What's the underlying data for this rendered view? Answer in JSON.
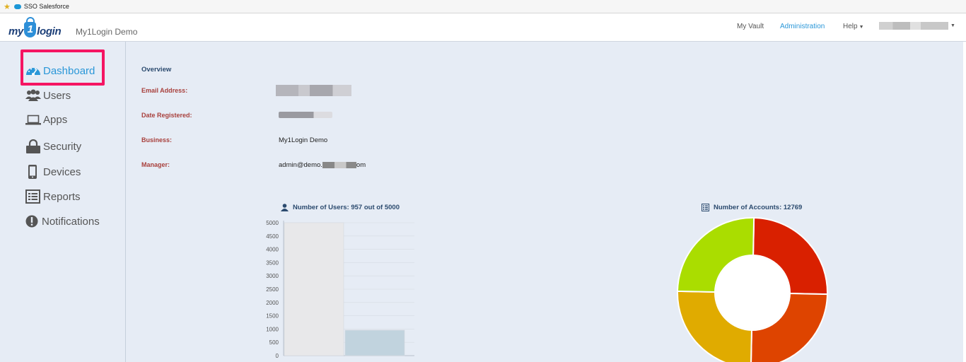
{
  "browser": {
    "bookmark_label": "SSO  Salesforce"
  },
  "header": {
    "logo_left": "my",
    "logo_one": "1",
    "logo_right": "login",
    "app_title": "My1Login Demo",
    "nav": {
      "vault": "My Vault",
      "admin": "Administration",
      "help": "Help"
    }
  },
  "sidebar": {
    "items": [
      {
        "label": "Dashboard",
        "icon": "dashboard-icon",
        "active": true
      },
      {
        "label": "Users",
        "icon": "users-icon"
      },
      {
        "label": "Apps",
        "icon": "laptop-icon"
      },
      {
        "label": "Security",
        "icon": "lock-icon"
      },
      {
        "label": "Devices",
        "icon": "mobile-icon"
      },
      {
        "label": "Reports",
        "icon": "reports-icon"
      },
      {
        "label": "Notifications",
        "icon": "exclamation-icon"
      }
    ]
  },
  "overview": {
    "title": "Overview",
    "email_label": "Email Address:",
    "date_label": "Date Registered:",
    "business_label": "Business:",
    "business_value": "My1Login Demo",
    "manager_label": "Manager:",
    "manager_prefix": "admin@demo.",
    "manager_suffix": "om"
  },
  "users_chart": {
    "title": "Number of Users: 957 out of 5000"
  },
  "accounts_chart": {
    "title": "Number of Accounts: 12769"
  },
  "colors": {
    "accent": "#2a97d8",
    "highlight": "#f51562",
    "label_red": "#a8403c"
  },
  "chart_data": [
    {
      "type": "bar",
      "title": "Number of Users: 957 out of 5000",
      "series": [
        {
          "values": [
            5000
          ]
        },
        {
          "values": [
            957
          ]
        }
      ],
      "ylim": [
        0,
        5000
      ],
      "yticks": [
        0,
        500,
        1000,
        1500,
        2000,
        2500,
        3000,
        3500,
        4000,
        4500,
        5000
      ],
      "series_colors": [
        "#e8e8ea",
        "#c1d3de"
      ],
      "grid": true
    },
    {
      "type": "pie",
      "donut": true,
      "title": "Number of Accounts: 12769",
      "slices": [
        {
          "value": 25,
          "color": "#d92000"
        },
        {
          "value": 25,
          "color": "#de4400"
        },
        {
          "value": 25,
          "color": "#e0ab00"
        },
        {
          "value": 25,
          "color": "#aadd00"
        }
      ]
    }
  ]
}
